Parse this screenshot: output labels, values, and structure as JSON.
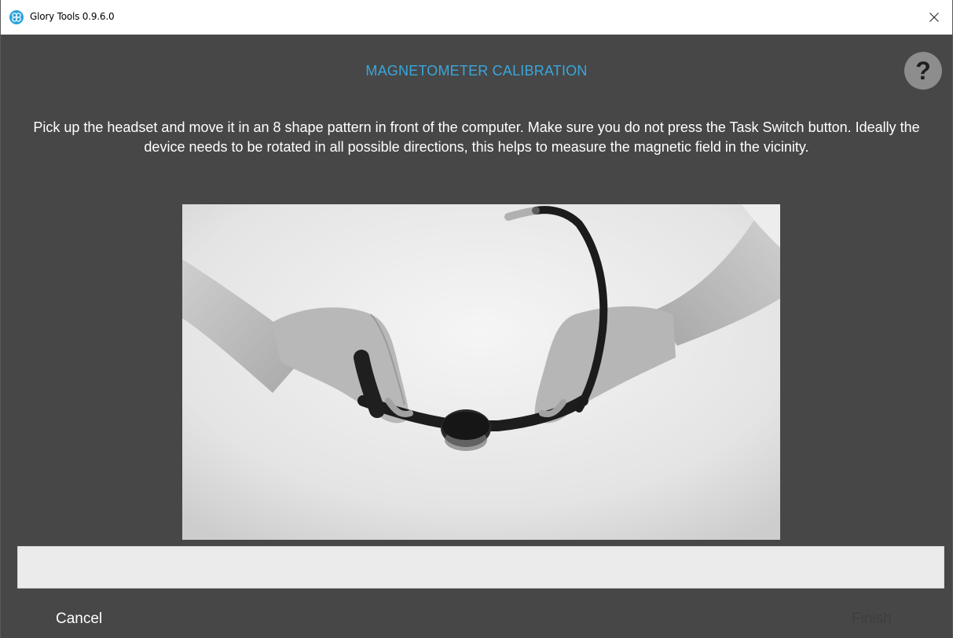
{
  "window": {
    "title": "Glory Tools 0.9.6.0"
  },
  "dialog": {
    "heading": "MAGNETOMETER CALIBRATION",
    "help_label": "?",
    "instructions": "Pick up the headset and move it in an 8 shape pattern in front of the computer. Make sure you do not press the Task Switch button. Ideally the device needs to be rotated in all possible directions, this helps to measure the magnetic field in the vicinity.",
    "status_text": "",
    "cancel_label": "Cancel",
    "finish_label": "Finish",
    "finish_enabled": false
  },
  "colors": {
    "background": "#474747",
    "heading": "#3aa6dc",
    "help_button": "#8d8d8d",
    "status_bar": "#ebebeb",
    "text": "#ffffff",
    "disabled_text": "#3e3e3e"
  },
  "icons": {
    "app": "glory-tools-logo-icon",
    "close": "close-icon",
    "illustration": "hands-holding-headset-illustration"
  }
}
